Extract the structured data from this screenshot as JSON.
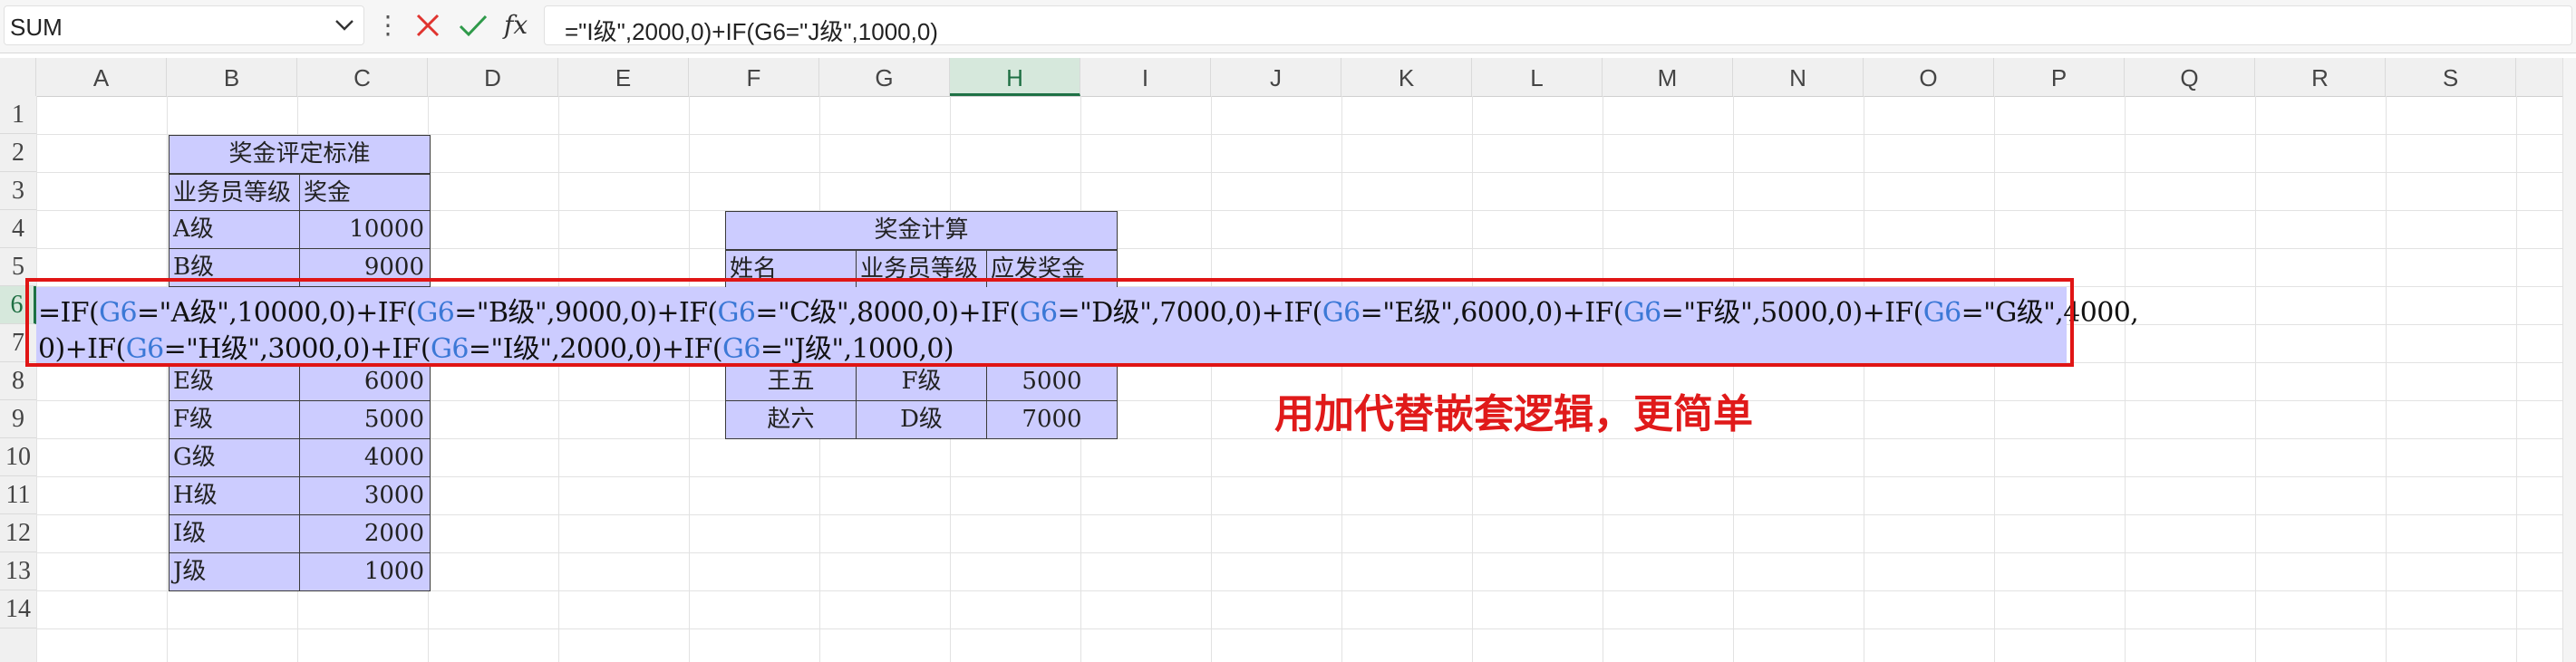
{
  "formula_bar": {
    "name_box": "SUM",
    "formula": "=\"I级\",2000,0)+IF(G6=\"J级\",1000,0)"
  },
  "columns": [
    "A",
    "B",
    "C",
    "D",
    "E",
    "F",
    "G",
    "H",
    "I",
    "J",
    "K",
    "L",
    "M",
    "N",
    "O",
    "P",
    "Q",
    "R",
    "S"
  ],
  "selected_column": "H",
  "rows": [
    "1",
    "2",
    "3",
    "4",
    "5",
    "6",
    "7",
    "8",
    "9",
    "10",
    "11",
    "12",
    "13",
    "14"
  ],
  "selected_row": "6",
  "criteria_table": {
    "title": "奖金评定标准",
    "header_level": "业务员等级",
    "header_bonus": "奖金",
    "rows": [
      {
        "level": "A级",
        "bonus": "10000"
      },
      {
        "level": "B级",
        "bonus": "9000"
      },
      {
        "level": "E级",
        "bonus": "6000"
      },
      {
        "level": "F级",
        "bonus": "5000"
      },
      {
        "level": "G级",
        "bonus": "4000"
      },
      {
        "level": "H级",
        "bonus": "3000"
      },
      {
        "level": "I级",
        "bonus": "2000"
      },
      {
        "level": "J级",
        "bonus": "1000"
      }
    ]
  },
  "calc_table": {
    "title": "奖金计算",
    "header_name": "姓名",
    "header_level": "业务员等级",
    "header_bonus": "应发奖金",
    "rows": [
      {
        "name": "王五",
        "level": "F级",
        "bonus": "5000"
      },
      {
        "name": "赵六",
        "level": "D级",
        "bonus": "7000"
      }
    ]
  },
  "editor": {
    "line1": [
      {
        "t": "=IF("
      },
      {
        "t": "G6",
        "ref": true
      },
      {
        "t": "=\"A级\",10000,0)+IF("
      },
      {
        "t": "G6",
        "ref": true
      },
      {
        "t": "=\"B级\",9000,0)+IF("
      },
      {
        "t": "G6",
        "ref": true
      },
      {
        "t": "=\"C级\",8000,0)+IF("
      },
      {
        "t": "G6",
        "ref": true
      },
      {
        "t": "=\"D级\",7000,0)+IF("
      },
      {
        "t": "G6",
        "ref": true
      },
      {
        "t": "=\"E级\",6000,0)+IF("
      },
      {
        "t": "G6",
        "ref": true
      },
      {
        "t": "=\"F级\",5000,0)+IF("
      },
      {
        "t": "G6",
        "ref": true
      },
      {
        "t": "=\"G级\",4000,"
      }
    ],
    "line2": [
      {
        "t": "0)+IF("
      },
      {
        "t": "G6",
        "ref": true
      },
      {
        "t": "=\"H级\",3000,0)+IF("
      },
      {
        "t": "G6",
        "ref": true
      },
      {
        "t": "=\"I级\",2000,0)+IF("
      },
      {
        "t": "G6",
        "ref": true
      },
      {
        "t": "=\"J级\",1000,0)"
      }
    ]
  },
  "annotation": "用加代替嵌套逻辑，更简单",
  "colors": {
    "cell_fill": "#ccccff",
    "ref_blue": "#3b78d6",
    "annotation_red": "#e01a1a",
    "selected_header": "#1e7145"
  },
  "icons": {
    "cancel": "close-icon",
    "enter": "check-icon",
    "function": "fx-icon",
    "dropdown": "chevron-down-icon",
    "more": "vertical-dots-icon"
  }
}
